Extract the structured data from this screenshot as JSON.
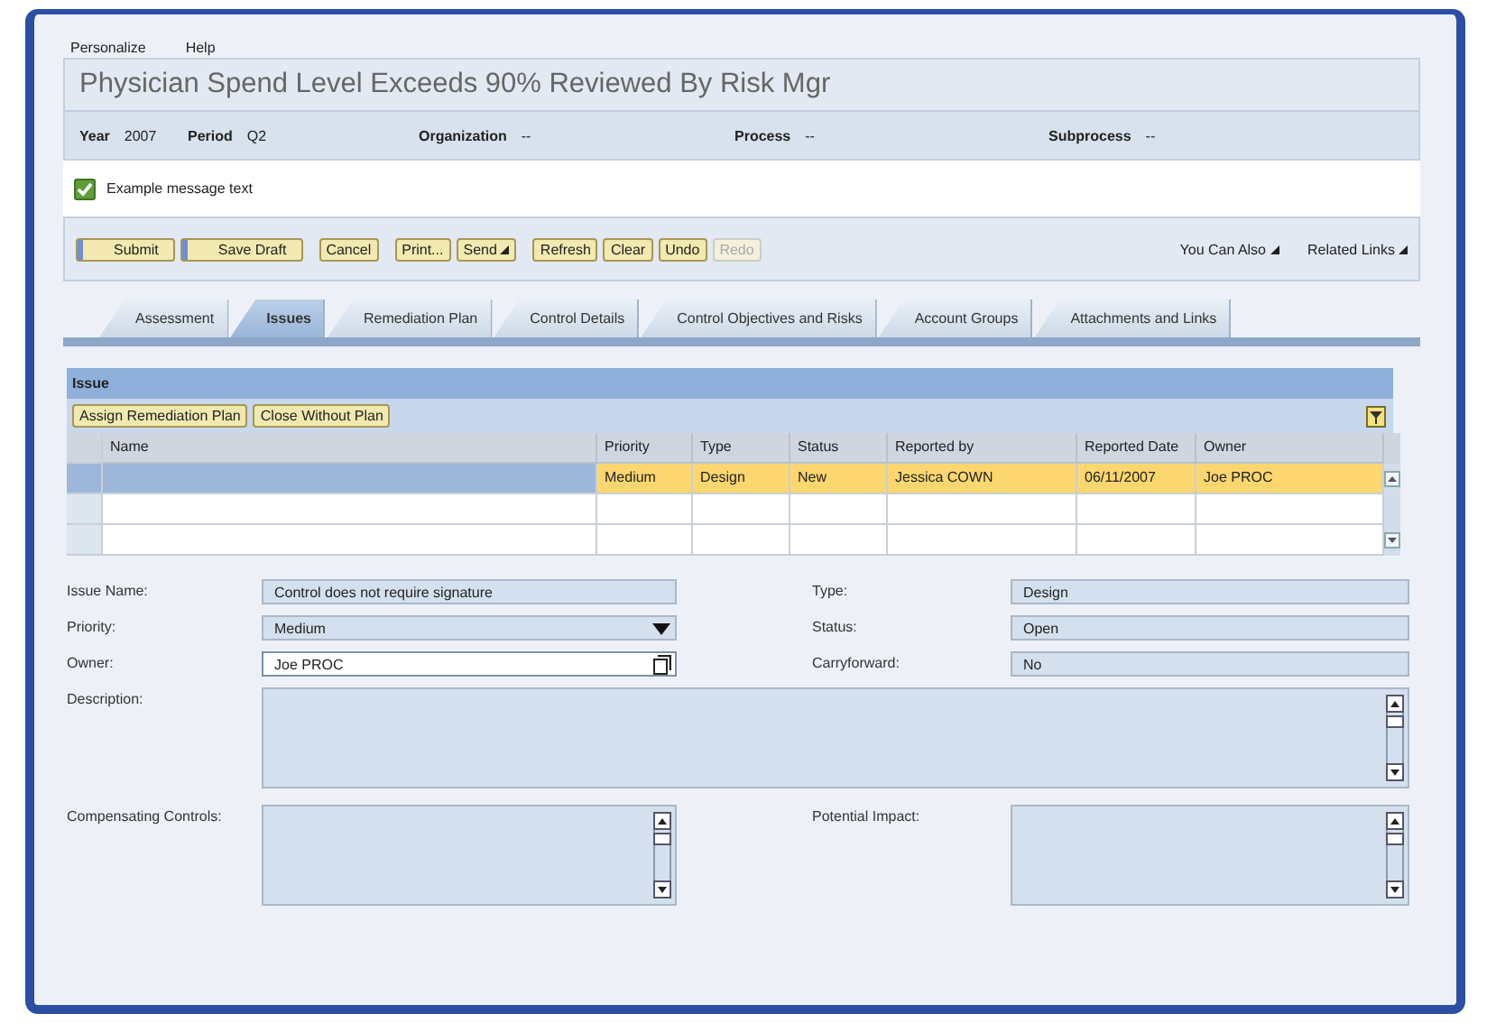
{
  "menu": [
    "Personalize",
    "Help"
  ],
  "title": "Physician Spend Level Exceeds 90% Reviewed By Risk Mgr",
  "context": [
    {
      "label": "Year",
      "value": "2007"
    },
    {
      "label": "Period",
      "value": "Q2"
    },
    {
      "label": "Organization",
      "value": "--"
    },
    {
      "label": "Process",
      "value": "--"
    },
    {
      "label": "Subprocess",
      "value": "--"
    }
  ],
  "message": {
    "kind": "success",
    "text": "Example message text"
  },
  "toolbar": {
    "groups": [
      [
        {
          "label": "Submit",
          "kind": "primary",
          "disabled": false
        },
        {
          "label": "Save Draft",
          "kind": "primary",
          "disabled": false
        }
      ],
      [
        {
          "label": "Cancel",
          "kind": "plain",
          "disabled": false
        }
      ],
      [
        {
          "label": "Print...",
          "kind": "plain",
          "disabled": false
        },
        {
          "label": "Send",
          "kind": "menu",
          "disabled": false
        }
      ],
      [
        {
          "label": "Refresh",
          "kind": "plain",
          "disabled": false
        },
        {
          "label": "Clear",
          "kind": "plain",
          "disabled": false
        },
        {
          "label": "Undo",
          "kind": "plain",
          "disabled": false
        },
        {
          "label": "Redo",
          "kind": "plain",
          "disabled": true
        }
      ]
    ],
    "links": [
      "You Can Also",
      "Related Links"
    ]
  },
  "tabs": [
    {
      "label": "Assessment",
      "selected": false
    },
    {
      "label": "Issues",
      "selected": true
    },
    {
      "label": "Remediation Plan",
      "selected": false
    },
    {
      "label": "Control Details",
      "selected": false
    },
    {
      "label": "Control Objectives and Risks",
      "selected": false
    },
    {
      "label": "Account Groups",
      "selected": false
    },
    {
      "label": "Attachments and Links",
      "selected": false
    }
  ],
  "issue": {
    "title": "Issue",
    "buttons": [
      "Assign Remediation Plan",
      "Close Without Plan"
    ],
    "table": {
      "columns": [
        "Name",
        "Priority",
        "Type",
        "Status",
        "Reported by",
        "Reported Date",
        "Owner"
      ],
      "rows": [
        {
          "selected": true,
          "cells": [
            "",
            "Medium",
            "Design",
            "New",
            "Jessica COWN",
            "06/11/2007",
            "Joe PROC"
          ]
        }
      ]
    }
  },
  "form": {
    "rows": [
      [
        {
          "label": "Issue Name:",
          "value": "Control does not require signature",
          "kind": "text",
          "editable": false
        },
        {
          "label": "Type:",
          "value": "Design",
          "kind": "text",
          "editable": false
        }
      ],
      [
        {
          "label": "Priority:",
          "value": "Medium",
          "kind": "dropdown",
          "editable": false
        },
        {
          "label": "Status:",
          "value": "Open",
          "kind": "text",
          "editable": false
        }
      ],
      [
        {
          "label": "Owner:",
          "value": "Joe PROC",
          "kind": "lookup",
          "editable": true
        },
        {
          "label": "Carryforward:",
          "value": "No",
          "kind": "text",
          "editable": false
        }
      ],
      [
        {
          "label": "Description:",
          "kind": "textarea",
          "editable": false
        }
      ],
      [
        {
          "label": "Compensating Controls:",
          "kind": "textarea",
          "editable": false
        },
        {
          "label": "Potential Impact:",
          "kind": "textarea",
          "editable": false
        }
      ]
    ]
  }
}
